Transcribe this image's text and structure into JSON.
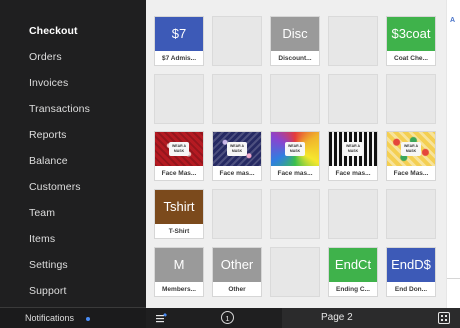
{
  "sidebar": {
    "items": [
      {
        "label": "Checkout",
        "active": true
      },
      {
        "label": "Orders"
      },
      {
        "label": "Invoices"
      },
      {
        "label": "Transactions"
      },
      {
        "label": "Reports"
      },
      {
        "label": "Balance"
      },
      {
        "label": "Customers"
      },
      {
        "label": "Team"
      },
      {
        "label": "Items"
      },
      {
        "label": "Settings"
      },
      {
        "label": "Support"
      }
    ],
    "notifications_label": "Notifications"
  },
  "grid": {
    "tiles": [
      {
        "thumb_text": "$7",
        "thumb_color": "#3d5ab7",
        "label": "$7 Admis..."
      },
      {
        "thumb_text": "Disc",
        "thumb_color": "#9a9a9a",
        "label": "Discount..."
      },
      {
        "thumb_text": "$3coat",
        "thumb_color": "#3fb24b",
        "label": "Coat Che..."
      },
      {
        "label": "Face Mas...",
        "pattern": "red",
        "badge": "WEAR A MASK"
      },
      {
        "label": "Face mas...",
        "pattern": "navy",
        "badge": "WEAR A MASK"
      },
      {
        "label": "Face mas...",
        "pattern": "tie",
        "badge": "WEAR A MASK"
      },
      {
        "label": "Face mas...",
        "pattern": "bw",
        "badge": "WEAR A MASK"
      },
      {
        "label": "Face Mas...",
        "pattern": "tacos",
        "badge": "WEAR A MASK"
      },
      {
        "thumb_text": "Tshirt",
        "thumb_color": "#7b4a1c",
        "label": "T-Shirt"
      },
      {
        "thumb_text": "M",
        "thumb_color": "#9a9a9a",
        "label": "Members..."
      },
      {
        "thumb_text": "Other",
        "thumb_color": "#9a9a9a",
        "label": "Other"
      },
      {
        "thumb_text": "EndCt",
        "thumb_color": "#3fb24b",
        "label": "Ending C..."
      },
      {
        "thumb_text": "EndD$",
        "thumb_color": "#3d5ab7",
        "label": "End Don..."
      }
    ]
  },
  "toolbar": {
    "page_one": "1",
    "page_two_label": "Page 2"
  },
  "right_panel": {
    "letter": "A"
  },
  "icons": {
    "menu": "menu-edit-icon",
    "grid": "grid-view-icon"
  },
  "colors": {
    "sidebar_bg": "#1f1f20",
    "accent_blue": "#3d5ab7",
    "accent_green": "#3fb24b",
    "notification_dot": "#4a8df5"
  }
}
